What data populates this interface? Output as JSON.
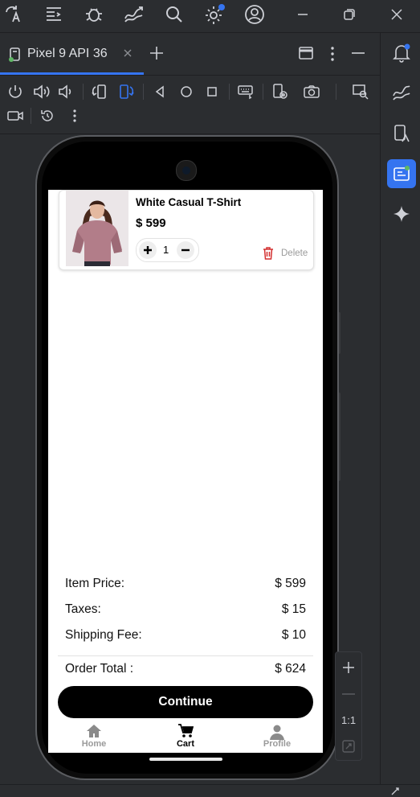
{
  "ide": {
    "top_icons": [
      "translate-icon",
      "structure-icon",
      "bug-icon",
      "chart-icon",
      "search-icon",
      "settings-icon",
      "account-icon"
    ],
    "window_controls": [
      "minimize-icon",
      "restore-icon",
      "close-icon"
    ],
    "tab_label": "Pixel 9 API 36",
    "accent_color": "#3574f0",
    "notification_dot_color": "#3574f0",
    "zoom_ratio_label": "1:1"
  },
  "app": {
    "cart_item": {
      "name": "White Casual T-Shirt",
      "price": "$ 599",
      "quantity": "1",
      "delete_label": "Delete"
    },
    "summary": {
      "item_price_label": "Item Price:",
      "item_price_value": "$ 599",
      "taxes_label": "Taxes:",
      "taxes_value": "$ 15",
      "shipping_label": "Shipping Fee:",
      "shipping_value": "$ 10",
      "total_label": "Order Total :",
      "total_value": "$ 624"
    },
    "continue_label": "Continue",
    "nav": {
      "home": "Home",
      "cart": "Cart",
      "profile": "Profile"
    },
    "delete_color": "#d32f2f"
  }
}
